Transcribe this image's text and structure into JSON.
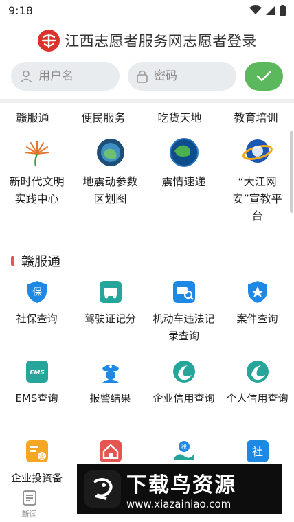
{
  "status_bar": {
    "time": "9:18",
    "icons": [
      "wifi-icon",
      "signal-icon",
      "battery-icon"
    ]
  },
  "header": {
    "title": "江西志愿者服务网志愿者登录",
    "logo": "volunteer-logo"
  },
  "login": {
    "username_placeholder": "用户名",
    "password_placeholder": "密码",
    "submit_icon": "check-icon",
    "submit_color": "#5cb85c"
  },
  "tabs": [
    "赣服通",
    "便民服务",
    "吃货天地",
    "教育培训"
  ],
  "featured": [
    {
      "label": "新时代文明实践中心",
      "icon": "civilization-practice-icon"
    },
    {
      "label": "地震动参数区划图",
      "icon": "earthquake-map-icon"
    },
    {
      "label": "震情速递",
      "icon": "earthquake-news-icon"
    },
    {
      "label": "“大江网安”宣教平台",
      "icon": "network-security-icon"
    }
  ],
  "section": {
    "title": "赣服通",
    "accent": "#e4564f"
  },
  "services": [
    {
      "label": "社保查询",
      "icon": "social-security-icon",
      "color": "#1e88e5"
    },
    {
      "label": "驾驶证记分",
      "icon": "driver-license-icon",
      "color": "#26a69a"
    },
    {
      "label": "机动车违法记录查询",
      "icon": "vehicle-violation-icon",
      "color": "#1e88e5"
    },
    {
      "label": "案件查询",
      "icon": "case-query-icon",
      "color": "#1e88e5"
    },
    {
      "label": "EMS查询",
      "icon": "ems-icon",
      "color": "#26a69a"
    },
    {
      "label": "报警结果",
      "icon": "police-icon",
      "color": "#1e88e5"
    },
    {
      "label": "企业信用查询",
      "icon": "enterprise-credit-icon",
      "color": "#26a69a"
    },
    {
      "label": "个人信用查询",
      "icon": "personal-credit-icon",
      "color": "#26a69a"
    },
    {
      "label": "企业投资备",
      "icon": "enterprise-investment-icon",
      "color": "#f5a623"
    },
    {
      "label": "",
      "icon": "housing-icon",
      "color": "#e4564f"
    },
    {
      "label": "",
      "icon": "tax-icon",
      "color": "#1e88e5"
    },
    {
      "label": "",
      "icon": "social-icon",
      "color": "#1e88e5"
    }
  ],
  "bottom_nav": [
    {
      "label": "新闻",
      "icon": "news-icon"
    },
    {
      "label": "",
      "icon": "nav-icon-2"
    },
    {
      "label": "",
      "icon": "nav-icon-3"
    },
    {
      "label": "",
      "icon": "nav-icon-4"
    },
    {
      "label": "",
      "icon": "nav-icon-5"
    }
  ],
  "watermark": {
    "title": "下载鸟资源",
    "url": "www.xiazainiao.com"
  }
}
